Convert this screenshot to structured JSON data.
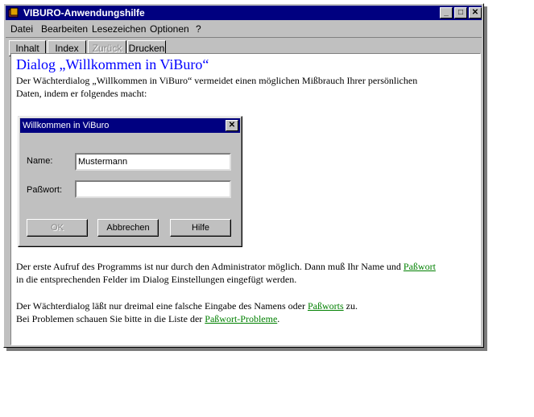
{
  "window": {
    "title": "VIBURO-Anwendungshilfe",
    "minimize": "_",
    "maximize": "□",
    "close": "✕"
  },
  "menu": [
    {
      "label": "Datei"
    },
    {
      "label": "Bearbeiten"
    },
    {
      "label": "Lesezeichen"
    },
    {
      "label": "Optionen"
    },
    {
      "label": "?"
    }
  ],
  "toolbar": {
    "inhalt": "Inhalt",
    "index": "Index",
    "zurueck": "Zurück",
    "drucken": "Drucken"
  },
  "content": {
    "heading": "Dialog „Willkommen in ViBuro“",
    "intro_line1": "Der Wächterdialog „Willkommen in ViBuro“ vermeidet einen möglichen Mißbrauch Ihrer persönlichen",
    "intro_line2": "Daten, indem er folgendes macht:",
    "p2_line1_prefix": "Der erste Aufruf des Programms ist nur durch den Administrator möglich. Dann muß Ihr Name und ",
    "p2_link": "Paßwort",
    "p2_line2": "in die entsprechenden Felder im Dialog Einstellungen eingefügt werden.",
    "p3_line1_prefix": "Der Wächterdialog läßt nur dreimal eine falsche Eingabe des Namens oder ",
    "p3_link": "Paßworts",
    "p3_line1_suffix": " zu.",
    "p3_line2_prefix": "Bei Problemen schauen Sie bitte in die Liste der ",
    "p3_link2": "Paßwort-Probleme",
    "p3_line2_suffix": "."
  },
  "dialog": {
    "title": "Willkommen in ViBuro",
    "close": "✕",
    "name_label": "Name:",
    "name_value": "Mustermann",
    "password_label": "Paßwort:",
    "password_value": "",
    "ok": "OK",
    "cancel": "Abbrechen",
    "help": "Hilfe"
  },
  "colors": {
    "titlebar": "#000080",
    "heading": "#0000ff",
    "link": "#008000"
  }
}
